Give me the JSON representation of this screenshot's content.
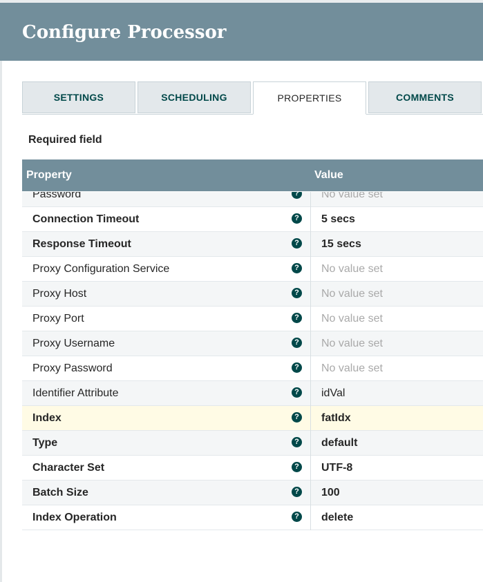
{
  "dialog": {
    "title": "Configure Processor"
  },
  "tabs": [
    {
      "label": "SETTINGS",
      "active": false
    },
    {
      "label": "SCHEDULING",
      "active": false
    },
    {
      "label": "PROPERTIES",
      "active": true
    },
    {
      "label": "COMMENTS",
      "active": false
    }
  ],
  "required_text": "Required field",
  "table": {
    "headers": {
      "property": "Property",
      "value": "Value"
    },
    "rows": [
      {
        "name": "Password",
        "value": "No value set",
        "required": false,
        "has_value": false
      },
      {
        "name": "Connection Timeout",
        "value": "5 secs",
        "required": true,
        "has_value": true
      },
      {
        "name": "Response Timeout",
        "value": "15 secs",
        "required": true,
        "has_value": true
      },
      {
        "name": "Proxy Configuration Service",
        "value": "No value set",
        "required": false,
        "has_value": false
      },
      {
        "name": "Proxy Host",
        "value": "No value set",
        "required": false,
        "has_value": false
      },
      {
        "name": "Proxy Port",
        "value": "No value set",
        "required": false,
        "has_value": false
      },
      {
        "name": "Proxy Username",
        "value": "No value set",
        "required": false,
        "has_value": false
      },
      {
        "name": "Proxy Password",
        "value": "No value set",
        "required": false,
        "has_value": false
      },
      {
        "name": "Identifier Attribute",
        "value": "idVal",
        "required": false,
        "has_value": true
      },
      {
        "name": "Index",
        "value": "fatIdx",
        "required": true,
        "has_value": true,
        "highlighted": true
      },
      {
        "name": "Type",
        "value": "default",
        "required": true,
        "has_value": true
      },
      {
        "name": "Character Set",
        "value": "UTF-8",
        "required": true,
        "has_value": true
      },
      {
        "name": "Batch Size",
        "value": "100",
        "required": true,
        "has_value": true
      },
      {
        "name": "Index Operation",
        "value": "delete",
        "required": true,
        "has_value": true
      }
    ],
    "help_icon": "question-circle-icon"
  },
  "colors": {
    "header_bg": "#728e9b",
    "help_icon": "#004849",
    "highlight_row": "#fffbe5",
    "unset_text": "#a9a9a9"
  }
}
